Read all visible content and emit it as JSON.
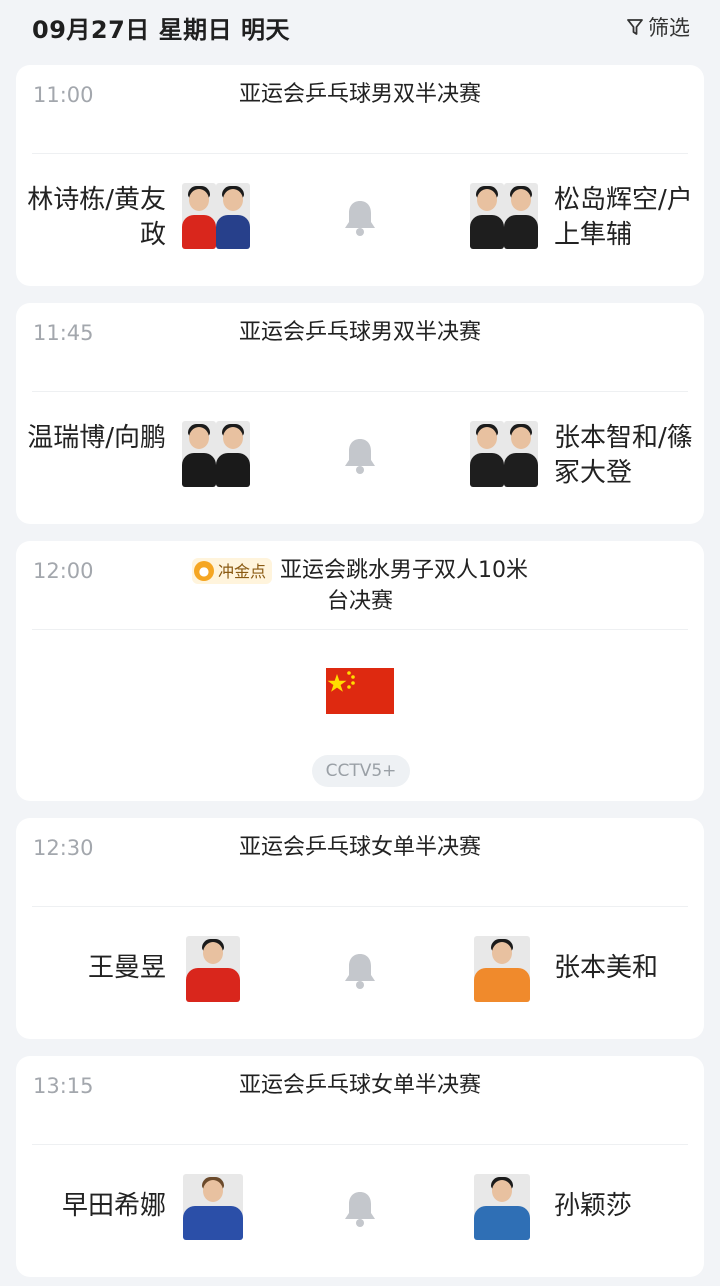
{
  "header": {
    "date": "09月27日 星期日 明天",
    "filter_label": "筛选"
  },
  "matches": [
    {
      "time": "11:00",
      "event": "亚运会乒乓球男双半决赛",
      "left_name": "林诗栋/黄友政",
      "right_name": "松岛辉空/户上隼辅"
    },
    {
      "time": "11:45",
      "event": "亚运会乒乓球男双半决赛",
      "left_name": "温瑞博/向鹏",
      "right_name": "张本智和/篠冢大登"
    },
    {
      "time": "12:00",
      "badge": "冲金点",
      "event": "亚运会跳水男子双人10米台决赛",
      "channel": "CCTV5+"
    },
    {
      "time": "12:30",
      "event": "亚运会乒乓球女单半决赛",
      "left_name": "王曼昱",
      "right_name": "张本美和"
    },
    {
      "time": "13:15",
      "event": "亚运会乒乓球女单半决赛",
      "left_name": "早田希娜",
      "right_name": "孙颖莎"
    }
  ],
  "colors": {
    "card_bg": "#ffffff",
    "page_bg": "#f2f4f7",
    "muted": "#a3a7ad",
    "bell": "#c4c7cc",
    "flag_red": "#de2910",
    "flag_star": "#ffde00"
  }
}
